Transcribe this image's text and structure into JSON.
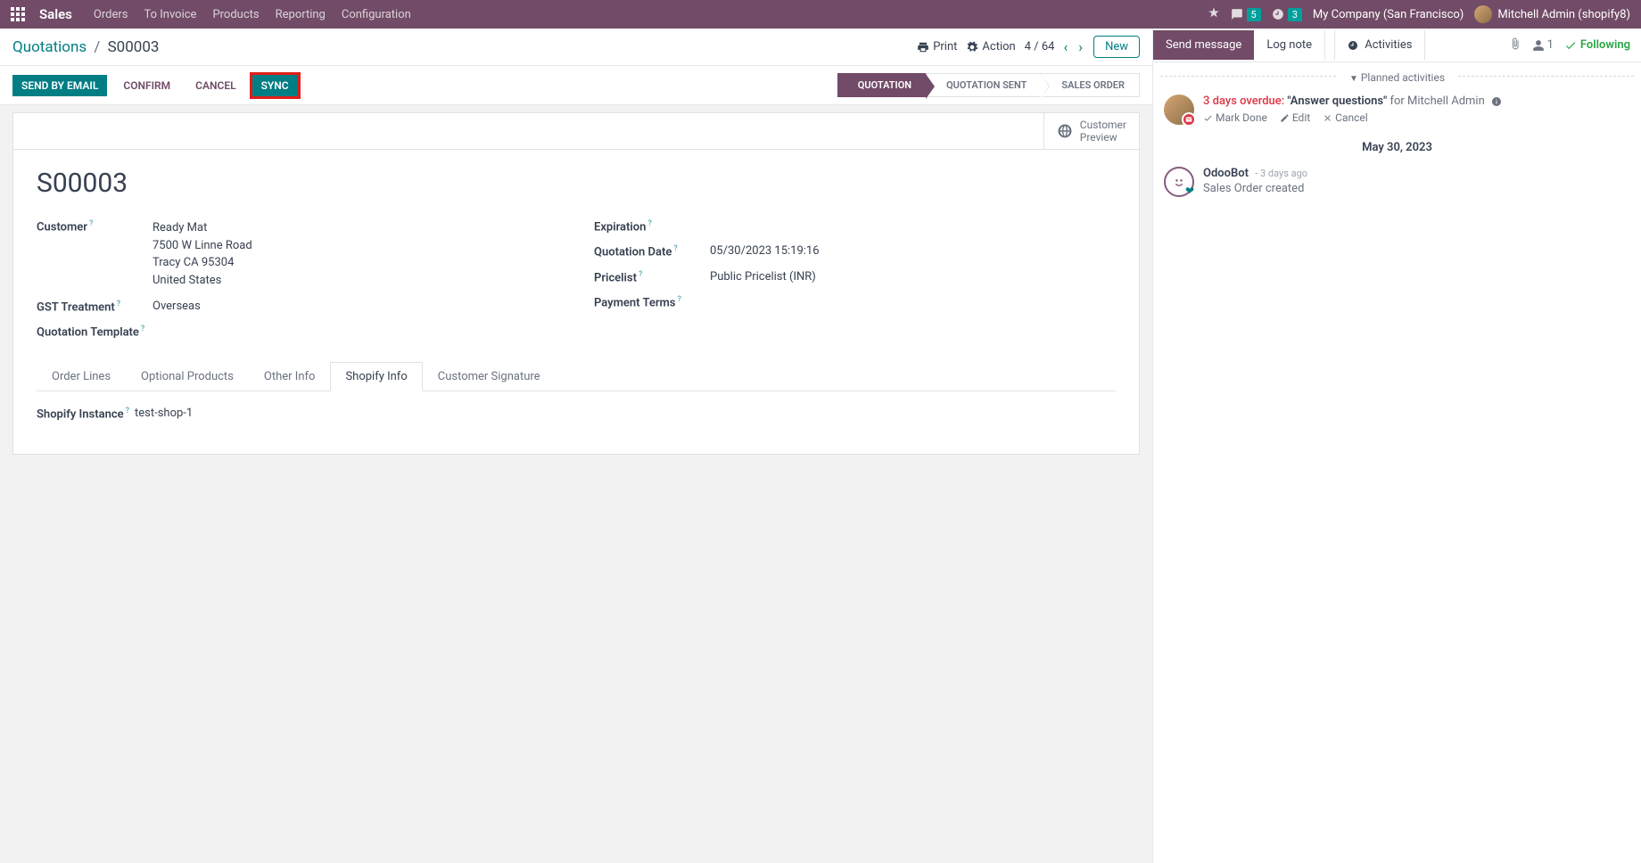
{
  "topbar": {
    "brand": "Sales",
    "nav": [
      "Orders",
      "To Invoice",
      "Products",
      "Reporting",
      "Configuration"
    ],
    "msg_count": "5",
    "clock_count": "3",
    "company": "My Company (San Francisco)",
    "user": "Mitchell Admin (shopify8)"
  },
  "breadcrumb": {
    "root": "Quotations",
    "current": "S00003",
    "print": "Print",
    "action": "Action",
    "pager": "4 / 64",
    "new": "New"
  },
  "buttons": {
    "send": "SEND BY EMAIL",
    "confirm": "CONFIRM",
    "cancel": "CANCEL",
    "sync": "SYNC"
  },
  "status": {
    "quotation": "QUOTATION",
    "sent": "QUOTATION SENT",
    "so": "SALES ORDER"
  },
  "preview": {
    "line1": "Customer",
    "line2": "Preview"
  },
  "record": {
    "title": "S00003",
    "customer_label": "Customer",
    "customer": {
      "name": "Ready Mat",
      "street": "7500 W Linne Road",
      "city": "Tracy CA 95304",
      "country": "United States"
    },
    "gst_label": "GST Treatment",
    "gst_value": "Overseas",
    "qtpl_label": "Quotation Template",
    "exp_label": "Expiration",
    "qdate_label": "Quotation Date",
    "qdate_value": "05/30/2023 15:19:16",
    "pricelist_label": "Pricelist",
    "pricelist_value": "Public Pricelist (INR)",
    "payterms_label": "Payment Terms"
  },
  "tabs": {
    "order_lines": "Order Lines",
    "optional": "Optional Products",
    "other": "Other Info",
    "shopify": "Shopify Info",
    "signature": "Customer Signature"
  },
  "shopify_tab": {
    "instance_label": "Shopify Instance",
    "instance_value": "test-shop-1"
  },
  "chatter": {
    "send": "Send message",
    "log": "Log note",
    "activities": "Activities",
    "followers": "1",
    "following": "Following",
    "planned": "Planned activities",
    "overdue": "3 days overdue:",
    "act_title": "\"Answer questions\"",
    "act_for": "for Mitchell Admin",
    "mark_done": "Mark Done",
    "edit": "Edit",
    "cancel": "Cancel",
    "date": "May 30, 2023",
    "bot_name": "OdooBot",
    "bot_time": "- 3 days ago",
    "bot_msg": "Sales Order created"
  }
}
